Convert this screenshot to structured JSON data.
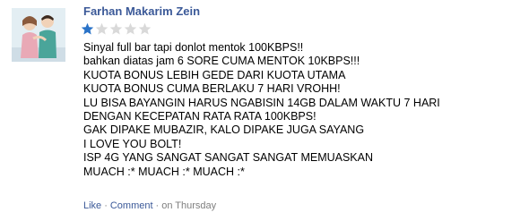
{
  "author": {
    "name": "Farhan Makarim Zein"
  },
  "rating": {
    "value": 1,
    "max": 5,
    "filled_color": "#2a73c8",
    "empty_color": "#d9d9d9"
  },
  "comment_lines": [
    "Sinyal full bar tapi donlot mentok 100KBPS!!",
    "bahkan diatas jam 6 SORE CUMA MENTOK 10KBPS!!!",
    "KUOTA BONUS LEBIH GEDE DARI KUOTA UTAMA",
    "KUOTA BONUS CUMA BERLAKU 7 HARI VROHH!",
    "LU BISA BAYANGIN HARUS NGABISIN 14GB DALAM WAKTU 7 HARI",
    "DENGAN KECEPATAN RATA RATA 100KBPS!",
    "GAK DIPAKE MUBAZIR, KALO DIPAKE JUGA SAYANG",
    "I LOVE YOU BOLT!",
    "ISP 4G YANG SANGAT SANGAT SANGAT MEMUASKAN",
    "MUACH :* MUACH :* MUACH :*"
  ],
  "footer": {
    "like_label": "Like",
    "comment_label": "Comment",
    "timestamp": "on Thursday",
    "separator": "·"
  },
  "colors": {
    "link": "#3b5998",
    "muted": "#7f7f7f"
  },
  "icons": {
    "avatar": "profile-photo",
    "star": "star-icon"
  }
}
